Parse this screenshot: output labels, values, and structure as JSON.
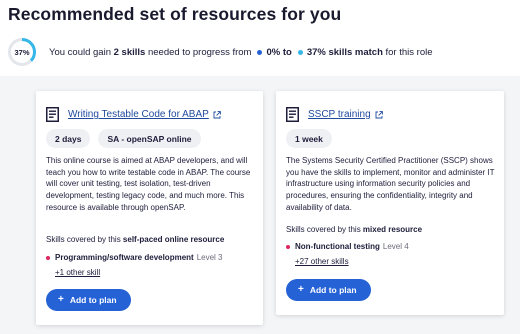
{
  "page": {
    "heading": "Recommended set of resources for you"
  },
  "progress": {
    "percent_label": "37%",
    "percent_value": 0.37,
    "text_prefix": "You could gain ",
    "skills_count": "2 skills",
    "text_mid": " needed to progress from",
    "from_label": "0% to",
    "to_label": "37% skills match",
    "text_suffix": " for this role",
    "colors": {
      "ring_fill": "#35b7e9",
      "ring_track": "#e3e6ea",
      "from_dot": "#2462d6",
      "to_dot": "#35b7e9"
    }
  },
  "cards": [
    {
      "title": "Writing Testable Code for ABAP",
      "tags": [
        "2 days",
        "SA - openSAP online"
      ],
      "description": "This online course is aimed at ABAP developers, and will teach you how to write testable code in ABAP. The course will cover unit testing, test isolation, test-driven development, testing legacy code, and much more. This resource is available through openSAP.",
      "skills_prefix": "Skills covered by this ",
      "skills_type": "self-paced online resource",
      "skill_name": "Programming/software development",
      "skill_level": "Level 3",
      "other_skills": "+1 other skill",
      "button_label": "Add to plan"
    },
    {
      "title": "SSCP training",
      "tags": [
        "1 week"
      ],
      "description": "The Systems Security Certified Practitioner (SSCP) shows you have the skills to implement, monitor and administer IT infrastructure using information security policies and procedures, ensuring the confidentiality, integrity and availability of data.",
      "skills_prefix": "Skills covered by this ",
      "skills_type": "mixed resource",
      "skill_name": "Non-functional testing",
      "skill_level": "Level 4",
      "other_skills": "+27 other skills",
      "button_label": "Add to plan"
    }
  ],
  "colors": {
    "accent": "#2462d6",
    "skill_bullet": "#e0245e",
    "link": "#1f4a9e"
  }
}
